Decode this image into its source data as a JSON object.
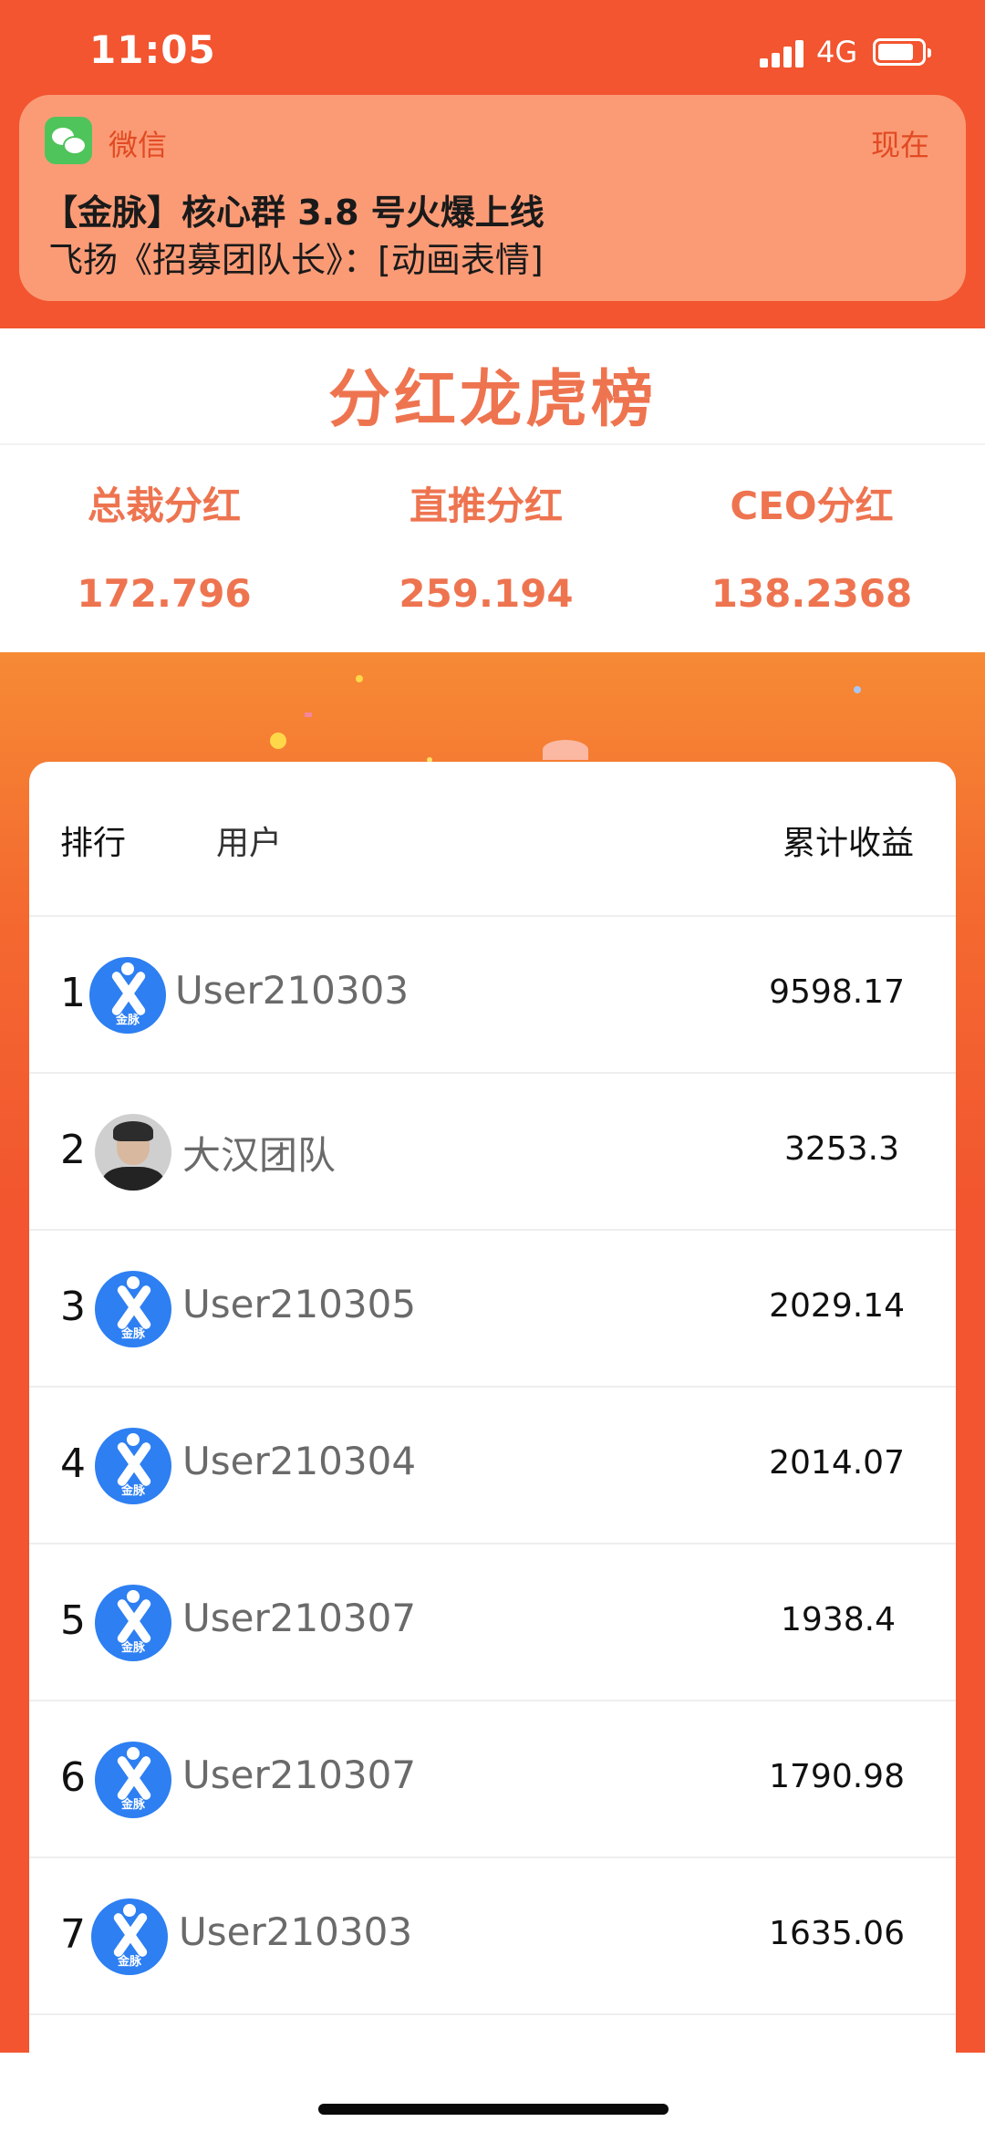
{
  "status_bar": {
    "time": "11:05",
    "network": "4G",
    "icons": [
      "signal-icon",
      "battery-icon"
    ]
  },
  "notification": {
    "app_name": "微信",
    "time": "现在",
    "title": "【金脉】核心群 3.8 号火爆上线",
    "body": "飞扬《招募团队长》：[动画表情]",
    "icon": "wechat-icon"
  },
  "summary": {
    "title": "分红龙虎榜",
    "stats": [
      {
        "label": "总裁分红",
        "value": "172.796"
      },
      {
        "label": "直推分红",
        "value": "259.194"
      },
      {
        "label": "CEO分红",
        "value": "138.2368"
      }
    ]
  },
  "leaderboard": {
    "headers": {
      "rank": "排行",
      "user": "用户",
      "total": "累计收益"
    },
    "avatar_brand": "金脉",
    "rows": [
      {
        "rank": "1",
        "name": "User210303",
        "value": "9598.17",
        "avatar": "logo"
      },
      {
        "rank": "2",
        "name": "大汉团队",
        "value": "3253.3",
        "avatar": "photo"
      },
      {
        "rank": "3",
        "name": "User210305",
        "value": "2029.14",
        "avatar": "logo"
      },
      {
        "rank": "4",
        "name": "User210304",
        "value": "2014.07",
        "avatar": "logo"
      },
      {
        "rank": "5",
        "name": "User210307",
        "value": "1938.4",
        "avatar": "logo"
      },
      {
        "rank": "6",
        "name": "User210307",
        "value": "1790.98",
        "avatar": "logo"
      },
      {
        "rank": "7",
        "name": "User210303",
        "value": "1635.06",
        "avatar": "logo"
      }
    ]
  },
  "colors": {
    "brand_orange": "#f2552f",
    "accent_text": "#ee7450",
    "notification_bg": "#fb9b76",
    "avatar_blue": "#2d7ff2",
    "wechat_green": "#4ec45a"
  }
}
